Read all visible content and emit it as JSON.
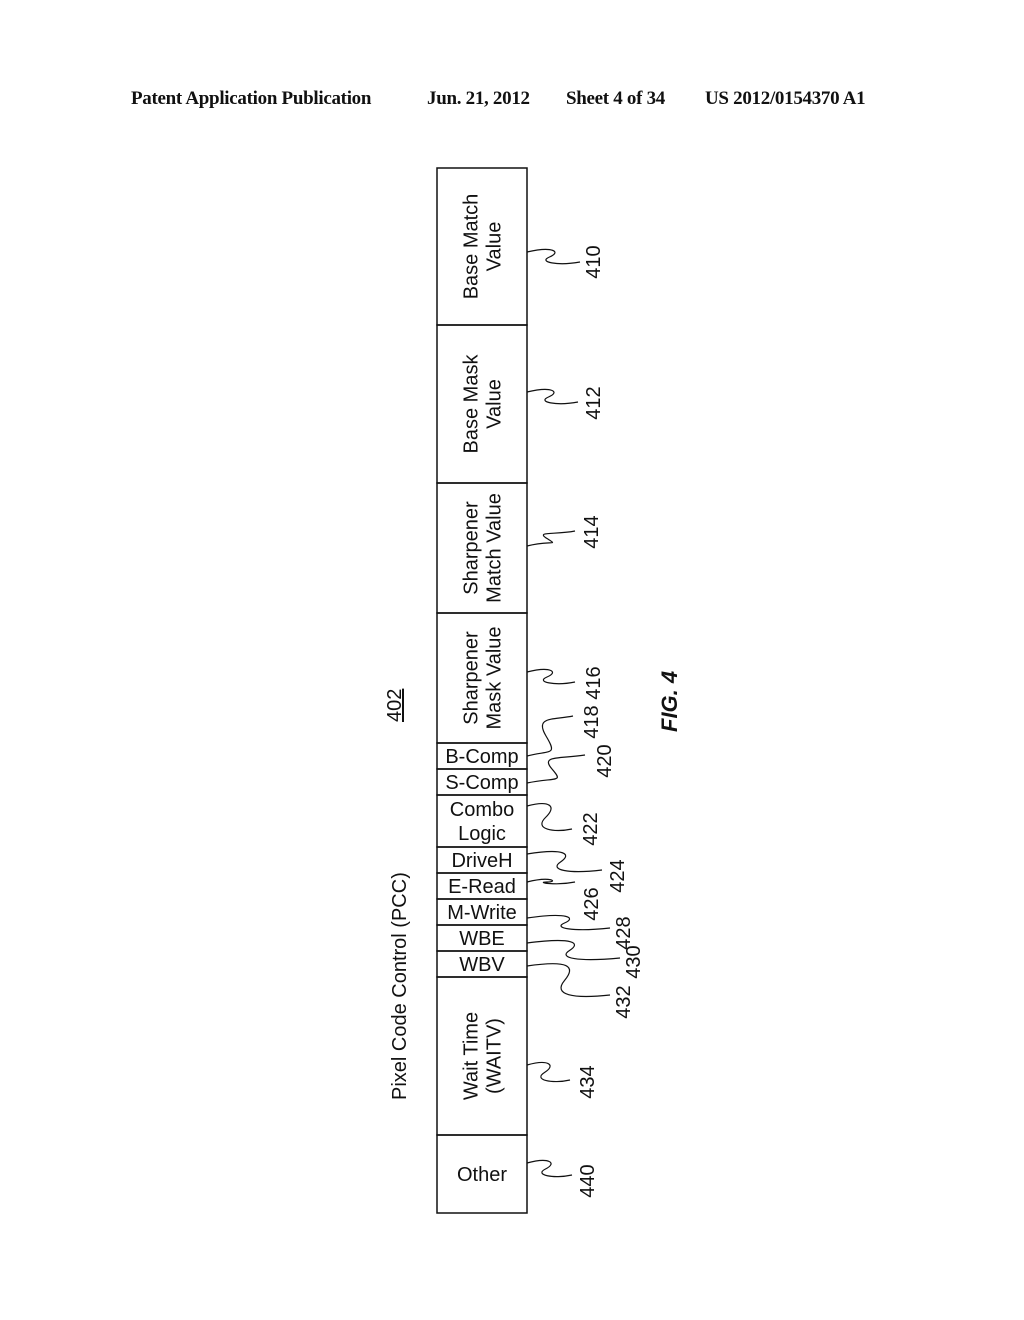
{
  "header": {
    "left": "Patent Application Publication",
    "date": "Jun. 21, 2012",
    "sheet": "Sheet 4 of 34",
    "number": "US 2012/0154370 A1"
  },
  "figure": {
    "label": "FIG. 4",
    "ref": "402",
    "title": "Pixel Code Control (PCC)",
    "fields": [
      {
        "lines": [
          "Base Match",
          "Value"
        ],
        "ref": "410"
      },
      {
        "lines": [
          "Base Mask",
          "Value"
        ],
        "ref": "412"
      },
      {
        "lines": [
          "Sharpener",
          "Match Value"
        ],
        "ref": "414"
      },
      {
        "lines": [
          "Sharpener",
          "Mask Value"
        ],
        "ref": "416"
      },
      {
        "lines": [
          "B-Comp"
        ],
        "ref": "418"
      },
      {
        "lines": [
          "S-Comp"
        ],
        "ref": "420"
      },
      {
        "lines": [
          "Combo",
          "Logic"
        ],
        "ref": "422"
      },
      {
        "lines": [
          "DriveH"
        ],
        "ref": "424"
      },
      {
        "lines": [
          "E-Read"
        ],
        "ref": "426"
      },
      {
        "lines": [
          "M-Write"
        ],
        "ref": "428"
      },
      {
        "lines": [
          "WBE"
        ],
        "ref": "430"
      },
      {
        "lines": [
          "WBV"
        ],
        "ref": "432"
      },
      {
        "lines": [
          "Wait Time",
          "(WAITV)"
        ],
        "ref": "434"
      },
      {
        "lines": [
          "Other"
        ],
        "ref": "440"
      }
    ]
  }
}
